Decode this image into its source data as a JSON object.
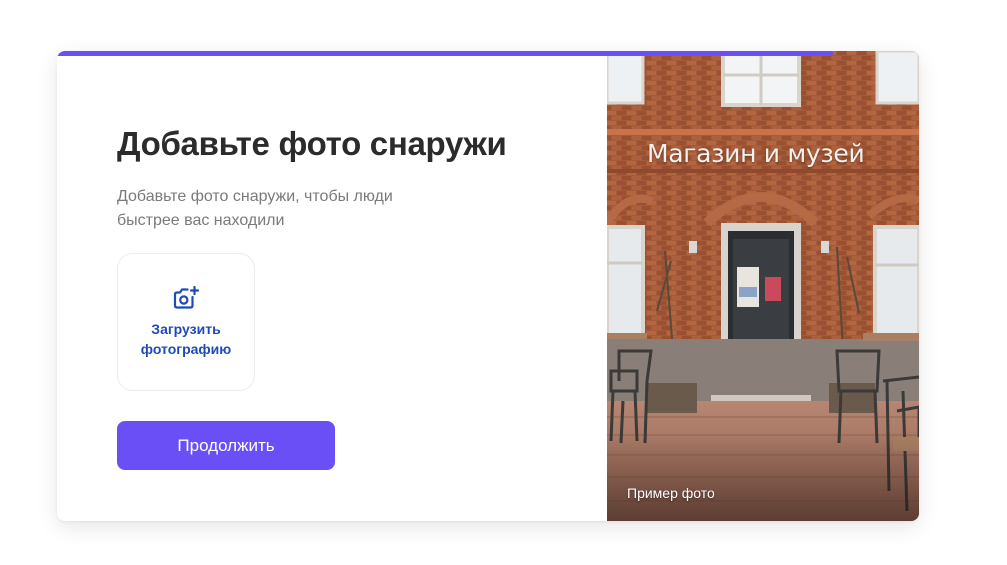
{
  "progress": {
    "value_percent": 90,
    "color": "#6b4ff6"
  },
  "form": {
    "title": "Добавьте фото снаружи",
    "subtitle": "Добавьте фото снаружи, чтобы люди быстрее вас находили",
    "upload": {
      "icon": "camera-plus-icon",
      "label": "Загрузить фотографию"
    },
    "continue_label": "Продолжить"
  },
  "example_photo": {
    "sign_text": "Магазин и музей",
    "caption": "Пример фото"
  },
  "colors": {
    "accent": "#6b4ff6",
    "link": "#1e4bb8",
    "title": "#2b2b2b",
    "subtitle": "#7a7a7a"
  }
}
